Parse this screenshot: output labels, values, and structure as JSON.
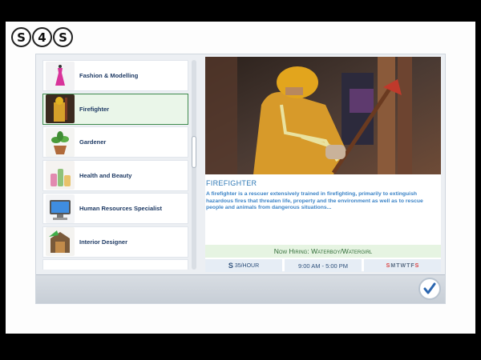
{
  "logo": {
    "letters": [
      "S",
      "4",
      "S"
    ]
  },
  "careers": [
    {
      "label": "Fashion & Modelling",
      "icon": "dress-icon",
      "selected": false
    },
    {
      "label": "Firefighter",
      "icon": "firefighter-icon",
      "selected": true
    },
    {
      "label": "Gardener",
      "icon": "plant-icon",
      "selected": false
    },
    {
      "label": "Health and Beauty",
      "icon": "cosmetics-icon",
      "selected": false
    },
    {
      "label": "Human Resources Specialist",
      "icon": "computer-icon",
      "selected": false
    },
    {
      "label": "Interior Designer",
      "icon": "interior-icon",
      "selected": false
    }
  ],
  "detail": {
    "title": "Firefighter",
    "description": "A firefighter is a rescuer extensively trained in firefighting, primarily to extinguish hazardous fires that threaten life, property and the environment as well as to rescue people and animals from dangerous situations...",
    "hiring": "Now Hiring: Waterboy/Watergirl",
    "pay_symbol": "S",
    "pay": "35/hour",
    "hours": "9:00 AM - 5:00 PM",
    "days": [
      "S",
      "M",
      "T",
      "W",
      "T",
      "F",
      "S"
    ]
  },
  "colors": {
    "accent": "#2f79b6",
    "selected_border": "#3e8a4d",
    "hiring_bg": "#e6f4e2",
    "day_off": "#d94040"
  }
}
